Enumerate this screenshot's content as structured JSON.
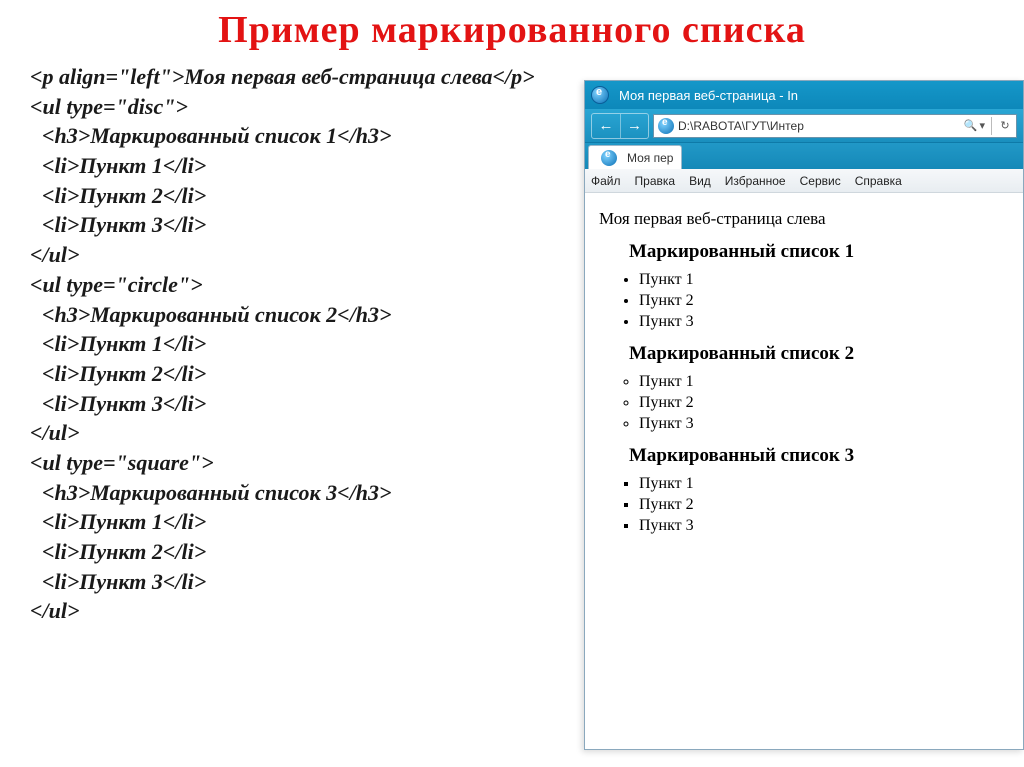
{
  "title": "Пример  маркированного  списка",
  "code": {
    "l1": "<p align=\"left\">Моя первая веб-страница слева</p>",
    "l2": "<ul type=\"disc\">",
    "l3": "<h3>Маркированный список 1</h3>",
    "l4": "<li>Пункт 1</li>",
    "l5": "<li>Пункт 2</li>",
    "l6": "<li>Пункт 3</li>",
    "l7": "</ul>",
    "l8": "<ul type=\"circle\">",
    "l9": "<h3>Маркированный список 2</h3>",
    "l10": "<li>Пункт 1</li>",
    "l11": "<li>Пункт 2</li>",
    "l12": "<li>Пункт 3</li>",
    "l13": "</ul>",
    "l14": "<ul type=\"square\">",
    "l15": "<h3>Маркированный список 3</h3>",
    "l16": "<li>Пункт 1</li>",
    "l17": "<li>Пункт 2</li>",
    "l18": "<li>Пункт 3</li>",
    "l19": "</ul>"
  },
  "browser": {
    "window_title": "Моя первая веб-страница - In",
    "address": "D:\\RABOTA\\ГУТ\\Интер",
    "search_glyph": "🔍",
    "dropdown_glyph": "▾",
    "refresh_glyph": "↻",
    "back_glyph": "←",
    "fwd_glyph": "→",
    "tab_label": "Моя пер",
    "menu": [
      "Файл",
      "Правка",
      "Вид",
      "Избранное",
      "Сервис",
      "Справка"
    ]
  },
  "page": {
    "intro": "Моя первая веб-страница слева",
    "lists": [
      {
        "heading": "Маркированный список 1",
        "style": "disc",
        "items": [
          "Пункт 1",
          "Пункт 2",
          "Пункт 3"
        ]
      },
      {
        "heading": "Маркированный список 2",
        "style": "circle",
        "items": [
          "Пункт 1",
          "Пункт 2",
          "Пункт 3"
        ]
      },
      {
        "heading": "Маркированный список 3",
        "style": "square",
        "items": [
          "Пункт 1",
          "Пункт 2",
          "Пункт 3"
        ]
      }
    ]
  }
}
